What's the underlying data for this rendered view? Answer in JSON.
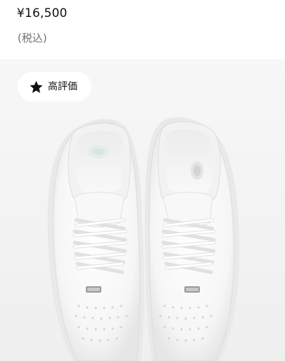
{
  "product": {
    "price": "¥16,500",
    "tax_note": "(税込)"
  },
  "badge": {
    "label": "高評価",
    "icon": "star-icon"
  },
  "image": {
    "subject": "white-sneakers-pair"
  },
  "colors": {
    "price_text": "#111111",
    "tax_text": "#707072",
    "image_background": "#f5f5f5",
    "badge_background": "#ffffff"
  }
}
